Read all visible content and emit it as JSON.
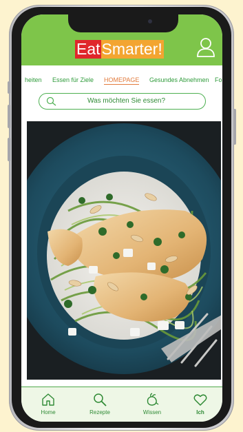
{
  "brand": {
    "part1": "Eat",
    "part2": "Smarter!"
  },
  "nav": {
    "items": [
      {
        "label": "heiten"
      },
      {
        "label": "Essen für Ziele"
      },
      {
        "label": "HOMEPAGE"
      },
      {
        "label": "Gesundes Abnehmen"
      },
      {
        "label": "Fo"
      }
    ],
    "active_index": 2
  },
  "search": {
    "placeholder": "Was möchten Sie essen?"
  },
  "hero": {
    "image": "grilled chicken breast on zucchini noodles with almonds and feta"
  },
  "tabbar": {
    "items": [
      {
        "label": "Home",
        "icon": "home-icon"
      },
      {
        "label": "Rezepte",
        "icon": "search-icon"
      },
      {
        "label": "Wissen",
        "icon": "vegetable-icon"
      },
      {
        "label": "Ich",
        "icon": "heart-icon"
      }
    ]
  },
  "colors": {
    "header": "#7ec54a",
    "accent_green": "#2f9b3b",
    "active_nav": "#e27a3b",
    "logo_red": "#e0262b",
    "logo_orange": "#f3a531",
    "tabbar_bg": "#eef7e6"
  }
}
